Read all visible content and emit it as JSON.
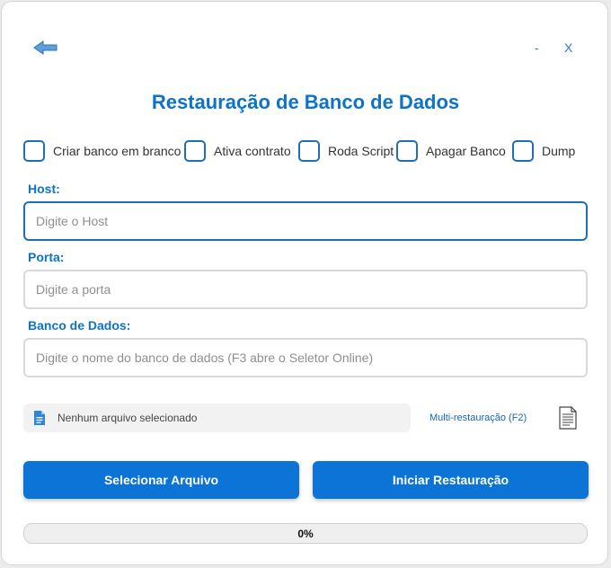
{
  "window": {
    "minimize_label": "-",
    "close_label": "X"
  },
  "title": "Restauração de Banco de Dados",
  "options": [
    {
      "label": "Criar banco em branco",
      "checked": false
    },
    {
      "label": "Ativa contrato",
      "checked": false
    },
    {
      "label": "Roda Script",
      "checked": false
    },
    {
      "label": "Apagar Banco",
      "checked": false
    },
    {
      "label": "Dump",
      "checked": false
    }
  ],
  "fields": {
    "host": {
      "label": "Host:",
      "placeholder": "Digite o Host",
      "value": ""
    },
    "porta": {
      "label": "Porta:",
      "placeholder": "Digite a porta",
      "value": ""
    },
    "banco": {
      "label": "Banco de Dados:",
      "placeholder": "Digite o nome do banco de dados (F3 abre o Seletor Online)",
      "value": ""
    }
  },
  "file": {
    "status_text": "Nenhum arquivo selecionado",
    "multi_link": "Multi-restauração (F2)"
  },
  "buttons": {
    "select_label": "Selecionar Arquivo",
    "start_label": "Iniciar Restauração"
  },
  "progress": {
    "percent": 0,
    "label": "0%"
  },
  "colors": {
    "accent": "#0b74d6",
    "title": "#0d73c9"
  },
  "icons": {
    "back": "back-arrow-icon",
    "file": "file-icon",
    "document": "document-icon"
  }
}
